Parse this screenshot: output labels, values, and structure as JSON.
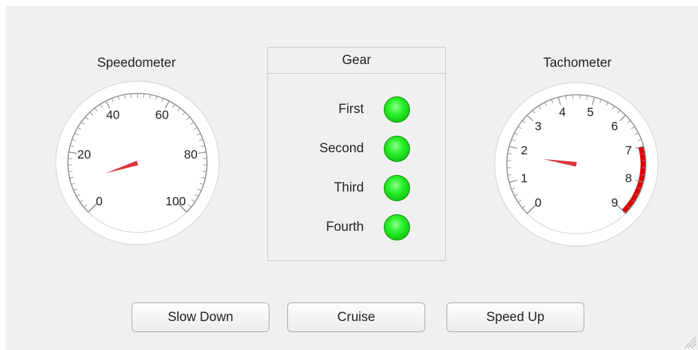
{
  "speedometer": {
    "title": "Speedometer",
    "scale_labels": [
      "0",
      "20",
      "40",
      "60",
      "80",
      "100"
    ],
    "min": 0,
    "max": 100,
    "value": 10
  },
  "tachometer": {
    "title": "Tachometer",
    "scale_labels": [
      "0",
      "1",
      "2",
      "3",
      "4",
      "5",
      "6",
      "7",
      "8",
      "9"
    ],
    "min": 0,
    "max": 9,
    "value": 1.8,
    "redline_start": 7
  },
  "gear": {
    "title": "Gear",
    "items": [
      {
        "label": "First",
        "lamp": "on"
      },
      {
        "label": "Second",
        "lamp": "on"
      },
      {
        "label": "Third",
        "lamp": "on"
      },
      {
        "label": "Fourth",
        "lamp": "on"
      }
    ],
    "lamp_color": "#22dd22"
  },
  "buttons": {
    "slow_down": "Slow Down",
    "cruise": "Cruise",
    "speed_up": "Speed Up"
  },
  "colors": {
    "needle": "#d9363e",
    "redline": "#e00000",
    "background": "#f0f0f0"
  }
}
